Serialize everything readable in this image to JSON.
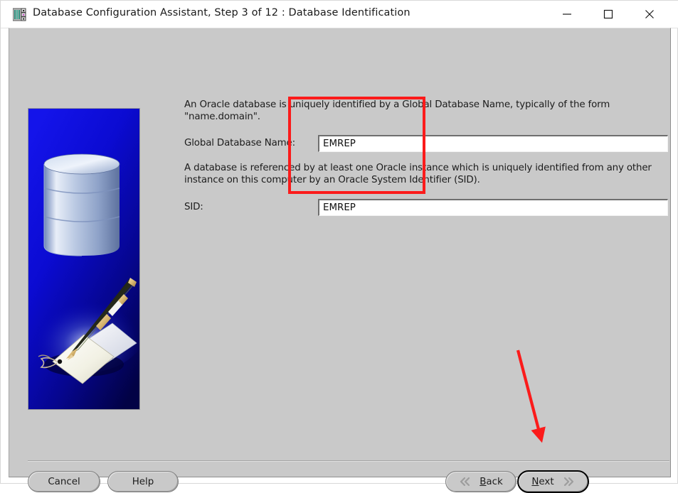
{
  "window": {
    "title": "Database Configuration Assistant, Step 3 of 12 : Database Identification",
    "icon": "database-app-icon",
    "controls": {
      "minimize": "minimize-icon",
      "maximize": "maximize-icon",
      "close": "close-icon"
    }
  },
  "sidebar": {
    "art_alt": "database-cylinder-and-pen-illustration",
    "background_color": "#0000d2"
  },
  "main": {
    "paragraph1": "An Oracle database is uniquely identified by a Global Database Name, typically of the form \"name.domain\".",
    "paragraph2": "A database is referenced by at least one Oracle instance which is uniquely identified from any other instance on this computer by an Oracle System Identifier (SID).",
    "fields": [
      {
        "label": "Global Database Name:",
        "value": "EMREP",
        "placeholder": ""
      },
      {
        "label": "SID:",
        "value": "EMREP",
        "placeholder": ""
      }
    ]
  },
  "buttons": {
    "cancel": "Cancel",
    "help": "Help",
    "back": {
      "mnemonic": "B",
      "rest": "ack",
      "icon": "double-chevron-left-icon"
    },
    "next": {
      "mnemonic": "N",
      "rest": "ext",
      "icon": "double-chevron-right-icon"
    }
  },
  "annotations": {
    "highlight_color": "#fb1b1b",
    "rectangle_target": "global-database-name-and-sid-fields",
    "arrow_target": "next-button"
  }
}
